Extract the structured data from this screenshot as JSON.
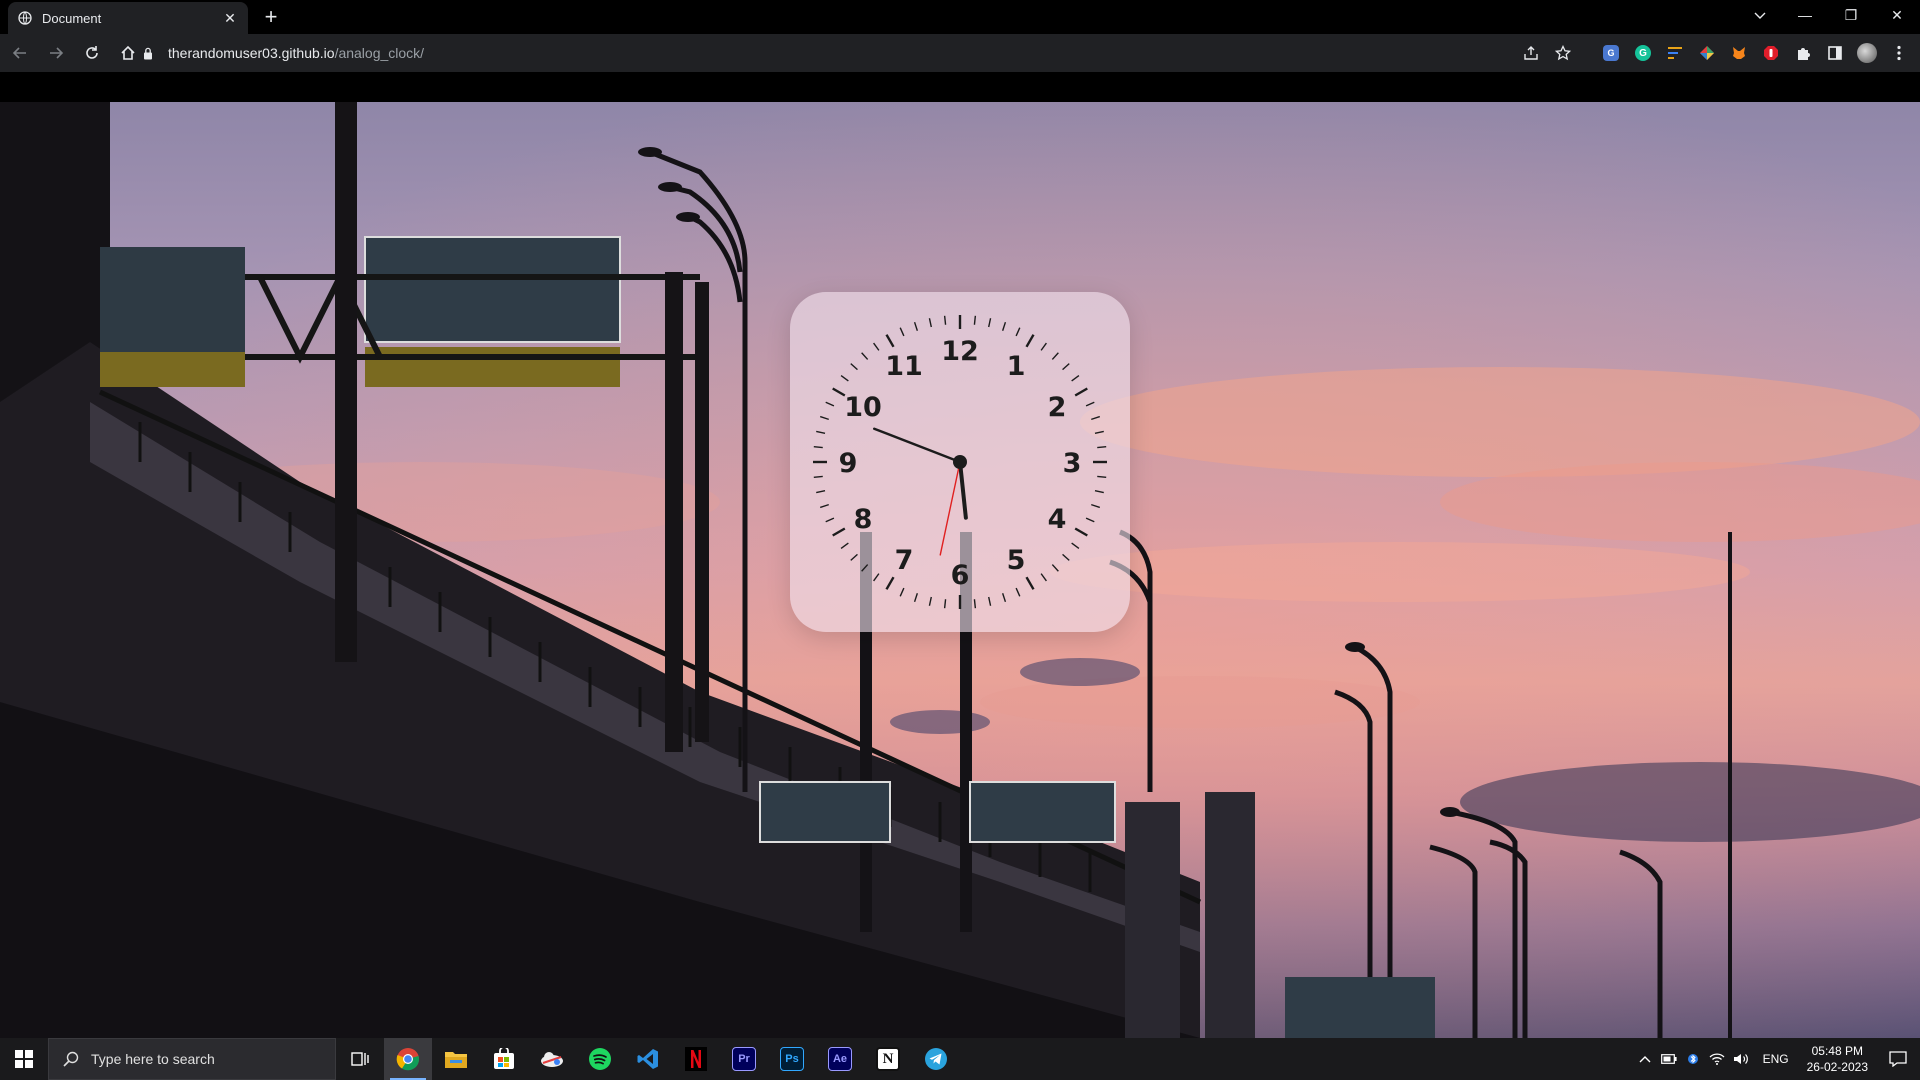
{
  "browser": {
    "tab": {
      "title": "Document",
      "close": "✕"
    },
    "new_tab": "+",
    "window_controls": {
      "minimize": "—",
      "restore": "❐",
      "close": "✕"
    },
    "url": {
      "host": "therandomuser03.github.io",
      "path": "/analog_clock/"
    }
  },
  "clock": {
    "numbers": [
      "12",
      "1",
      "2",
      "3",
      "4",
      "5",
      "6",
      "7",
      "8",
      "9",
      "10",
      "11"
    ],
    "hands": {
      "hour": 5,
      "minute": 48,
      "second": 32
    },
    "colors": {
      "hands": "#1c1c1c",
      "second_hand": "#e02020",
      "card": "rgba(240,225,235,0.62)"
    }
  },
  "taskbar": {
    "search_placeholder": "Type here to search",
    "apps": [
      "chrome-icon",
      "file-explorer-icon",
      "store-icon",
      "cloud-icon",
      "spotify-icon",
      "vscode-icon",
      "netflix-icon",
      "premiere-icon",
      "photoshop-icon",
      "after-effects-icon",
      "notion-icon",
      "telegram-icon"
    ],
    "app_labels": {
      "premiere": "Pr",
      "photoshop": "Ps",
      "after_effects": "Ae",
      "notion": "N"
    },
    "language": "ENG",
    "time": "05:48 PM",
    "date": "26-02-2023"
  }
}
